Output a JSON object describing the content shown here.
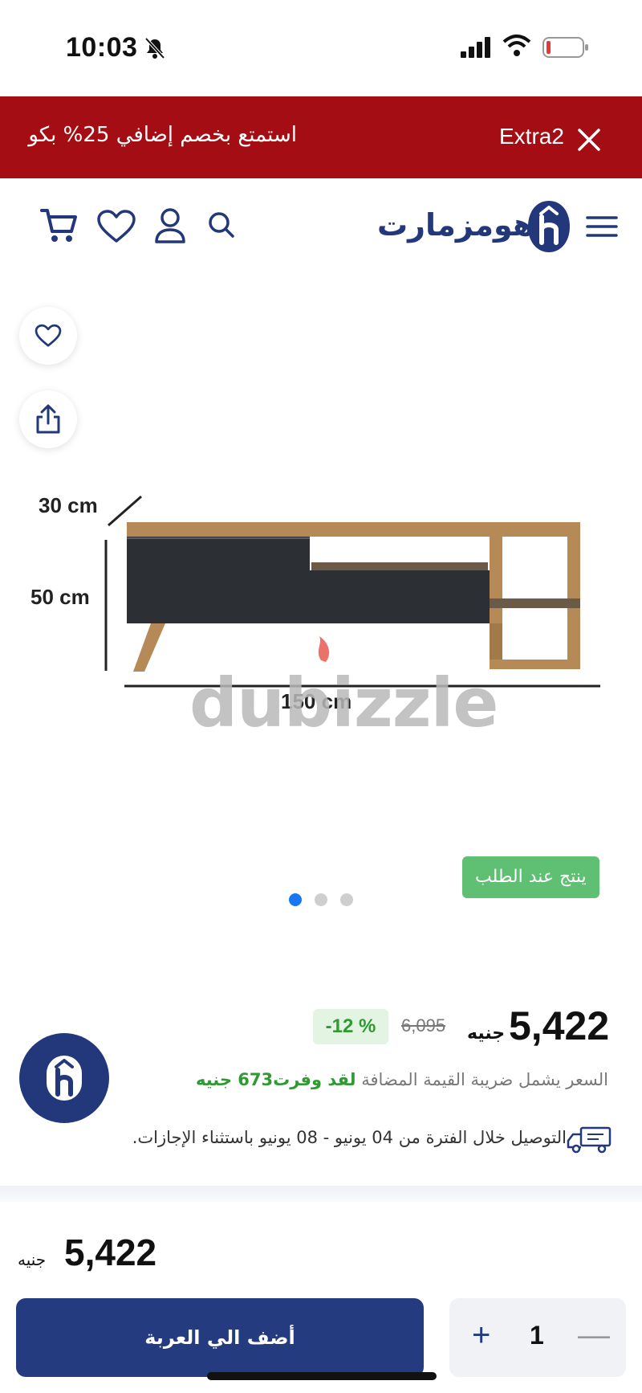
{
  "status_bar": {
    "time": "10:03"
  },
  "banner": {
    "text": "استمتع بخصم إضافي 25% بكو",
    "code": "Extra2",
    "bg_color": "#a30d13"
  },
  "header": {
    "brand": "هومزمارت",
    "icons": [
      "menu-icon",
      "logo",
      "search-icon",
      "user-icon",
      "heart-icon",
      "cart-icon"
    ]
  },
  "gallery": {
    "dimensions": {
      "depth": "30 cm",
      "height": "50 cm",
      "width": "150 cm"
    },
    "watermark": "dubizzle",
    "badge": "ينتج عند الطلب",
    "dots": {
      "count": 3,
      "active": 1
    }
  },
  "price": {
    "current": "5,422",
    "currency": "جنيه",
    "old": "6,095",
    "discount": "-12 %",
    "vat_note": "السعر يشمل ضريبة القيمة المضافة",
    "saved": "لقد وفرت673 جنيه",
    "delivery": "التوصيل خلال الفترة من 04 يونيو - 08 يونيو باستثناء الإجازات."
  },
  "bottom_bar": {
    "price": "5,422",
    "currency": "جنيه",
    "add_to_cart": "أضف الي العربة",
    "quantity": "1",
    "plus": "+",
    "minus": "—"
  },
  "colors": {
    "brand": "#23387b",
    "accent_green": "#2f9a32",
    "badge_green": "#5fbf72",
    "dot_active": "#1877f2"
  }
}
